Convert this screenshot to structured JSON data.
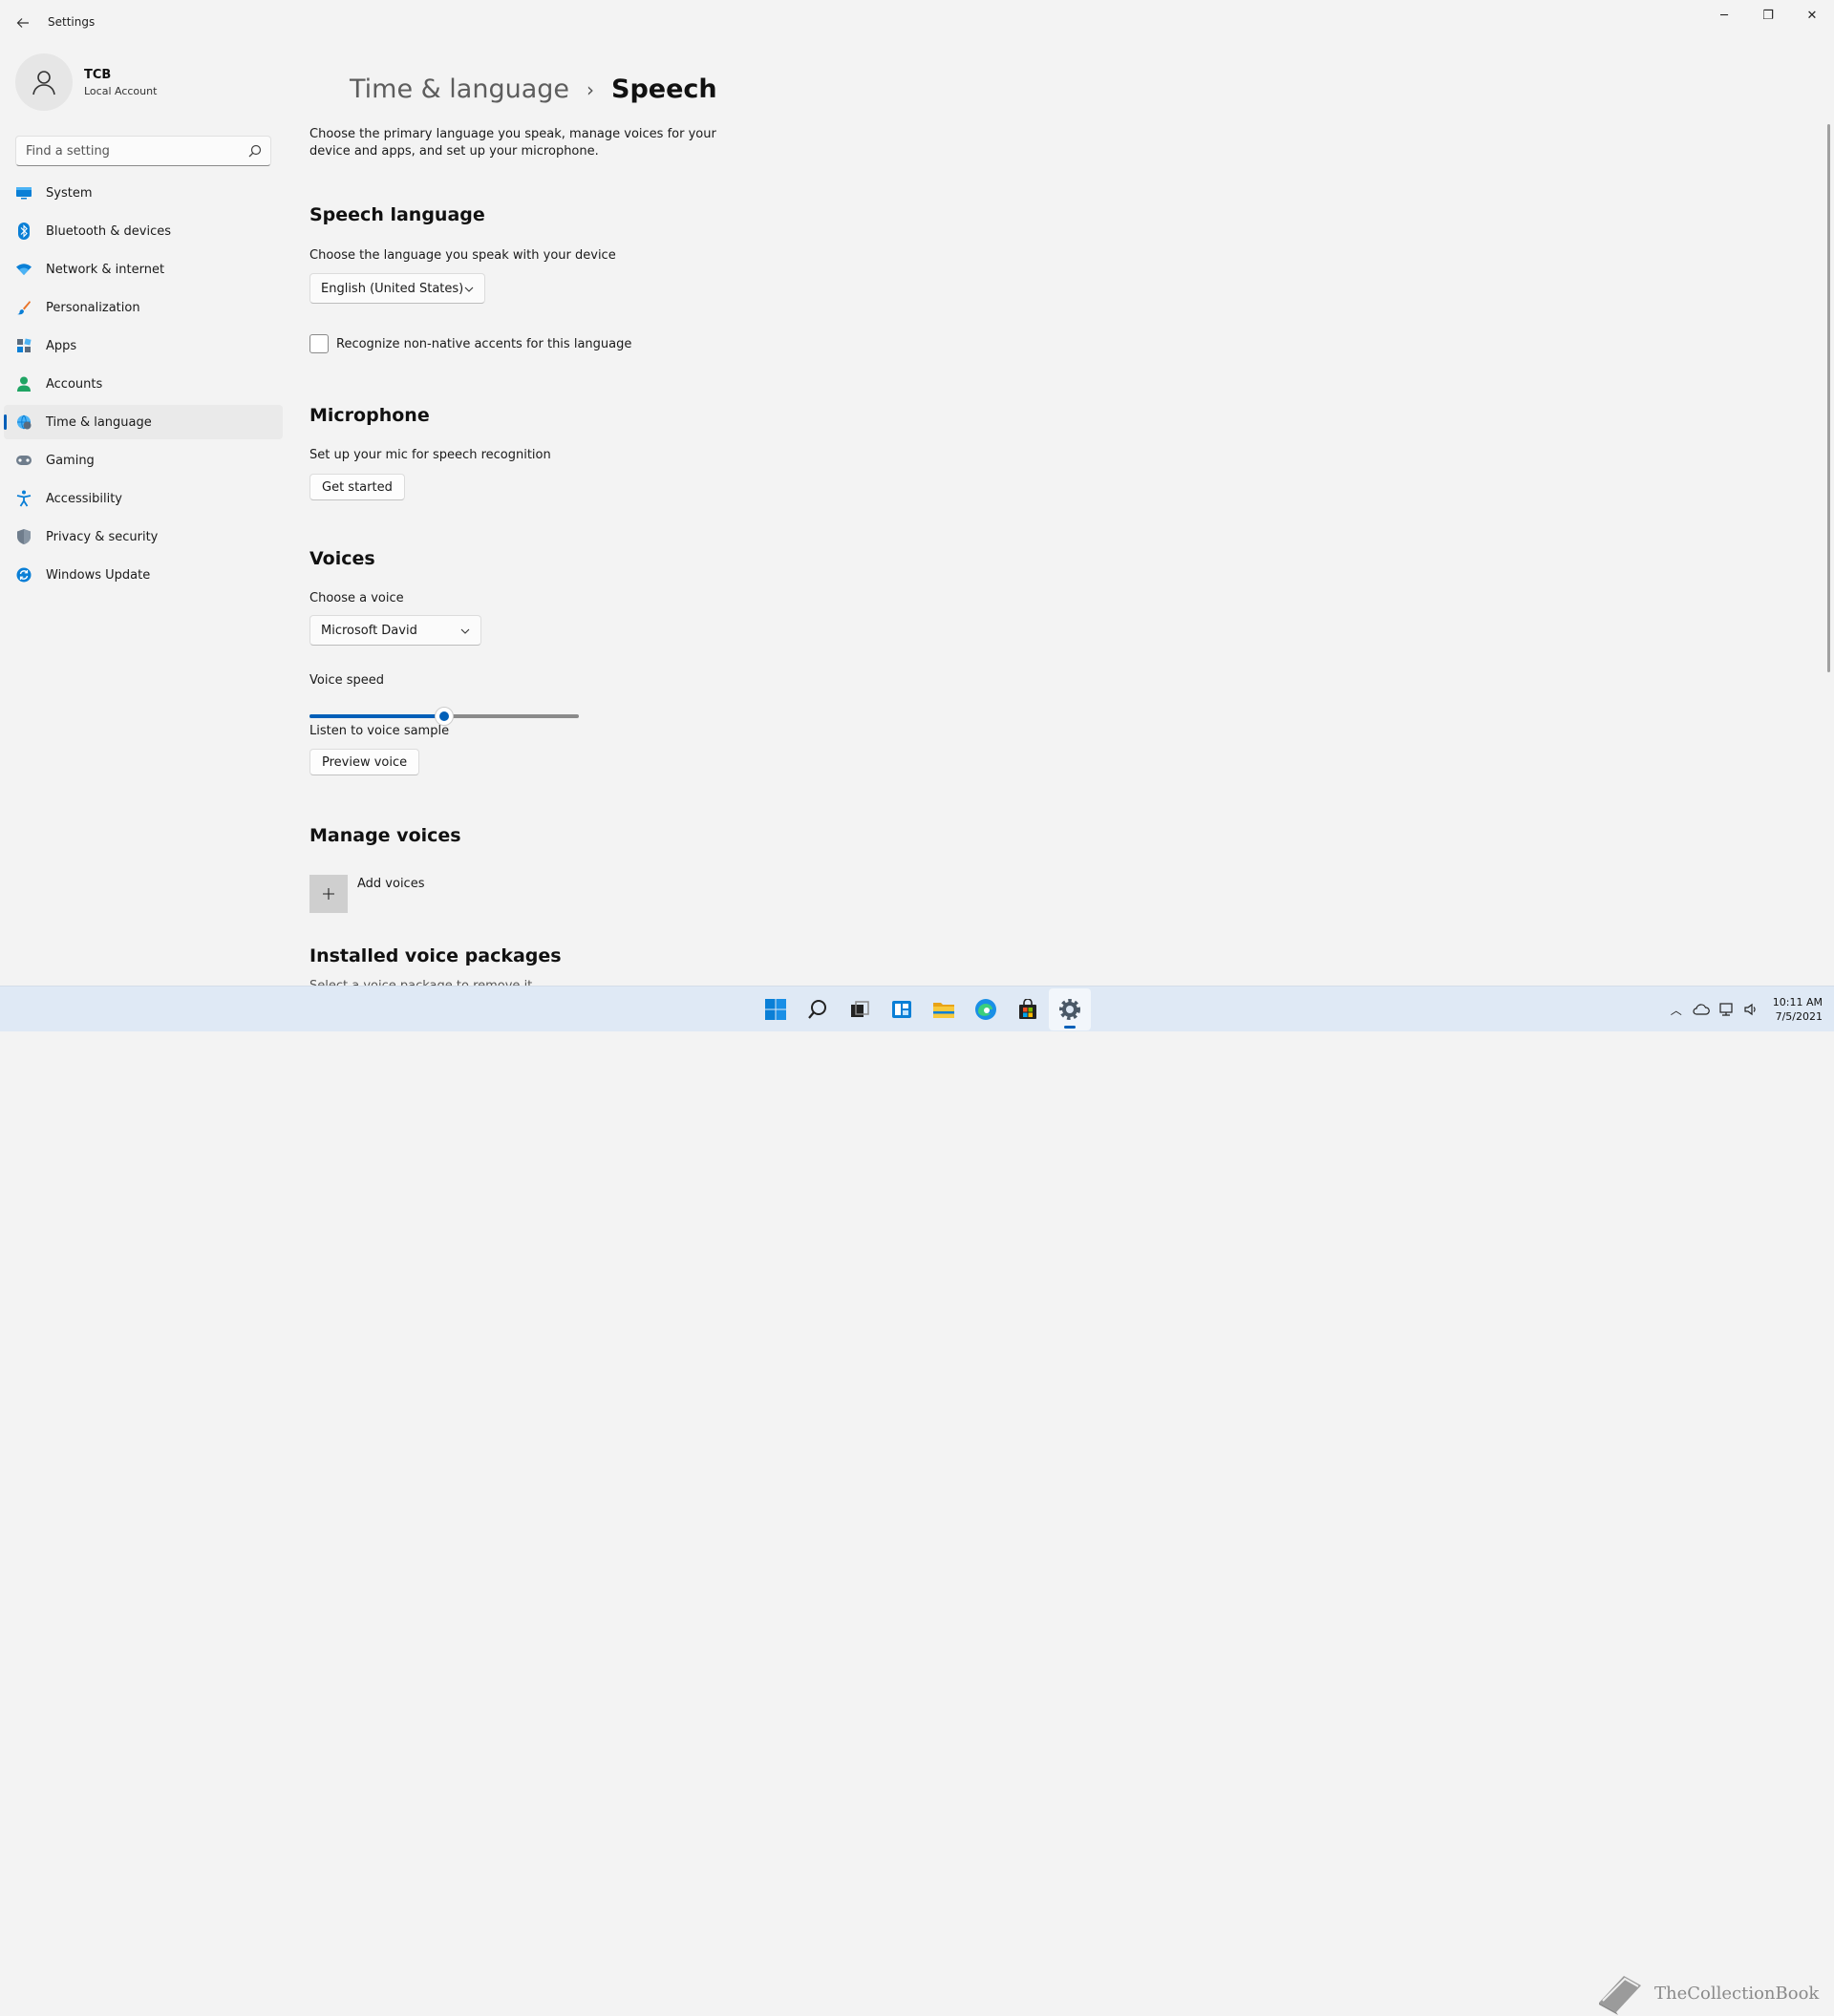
{
  "window": {
    "title": "Settings",
    "controls": {
      "minimize": "─",
      "maximize": "❐",
      "close": "✕"
    }
  },
  "profile": {
    "name": "TCB",
    "account_type": "Local Account"
  },
  "search": {
    "placeholder": "Find a setting"
  },
  "sidebar": {
    "items": [
      {
        "label": "System",
        "icon": "monitor-icon"
      },
      {
        "label": "Bluetooth & devices",
        "icon": "bluetooth-icon"
      },
      {
        "label": "Network & internet",
        "icon": "wifi-icon"
      },
      {
        "label": "Personalization",
        "icon": "brush-icon"
      },
      {
        "label": "Apps",
        "icon": "apps-icon"
      },
      {
        "label": "Accounts",
        "icon": "person-icon"
      },
      {
        "label": "Time & language",
        "icon": "globe-clock-icon",
        "active": true
      },
      {
        "label": "Gaming",
        "icon": "gamepad-icon"
      },
      {
        "label": "Accessibility",
        "icon": "accessibility-icon"
      },
      {
        "label": "Privacy & security",
        "icon": "shield-icon"
      },
      {
        "label": "Windows Update",
        "icon": "update-icon"
      }
    ]
  },
  "breadcrumb": {
    "parent": "Time & language",
    "separator": "›",
    "current": "Speech"
  },
  "page": {
    "description": "Choose the primary language you speak, manage voices for your device and apps, and set up your microphone.",
    "speech_language": {
      "title": "Speech language",
      "label": "Choose the language you speak with your device",
      "selected": "English (United States)",
      "checkbox_label": "Recognize non-native accents for this language",
      "checkbox_checked": false
    },
    "microphone": {
      "title": "Microphone",
      "label": "Set up your mic for speech recognition",
      "button": "Get started"
    },
    "voices": {
      "title": "Voices",
      "choose_label": "Choose a voice",
      "selected_voice": "Microsoft David",
      "speed_label": "Voice speed",
      "speed_value": 0.5,
      "sample_label": "Listen to voice sample",
      "preview_button": "Preview voice"
    },
    "manage_voices": {
      "title": "Manage voices",
      "add_label": "Add voices"
    },
    "installed": {
      "title": "Installed voice packages",
      "subtitle": "Select a voice package to remove it"
    }
  },
  "taskbar": {
    "apps": [
      "start-icon",
      "search-icon",
      "task-view-icon",
      "widgets-icon",
      "file-explorer-icon",
      "edge-icon",
      "store-icon",
      "settings-icon"
    ],
    "clock_time": "10:11 AM",
    "clock_date": "7/5/2021",
    "watermark": "TheCollectionBook"
  },
  "colors": {
    "accent": "#005fb8",
    "background": "#f3f3f3",
    "taskbar": "#dfe9f5"
  }
}
